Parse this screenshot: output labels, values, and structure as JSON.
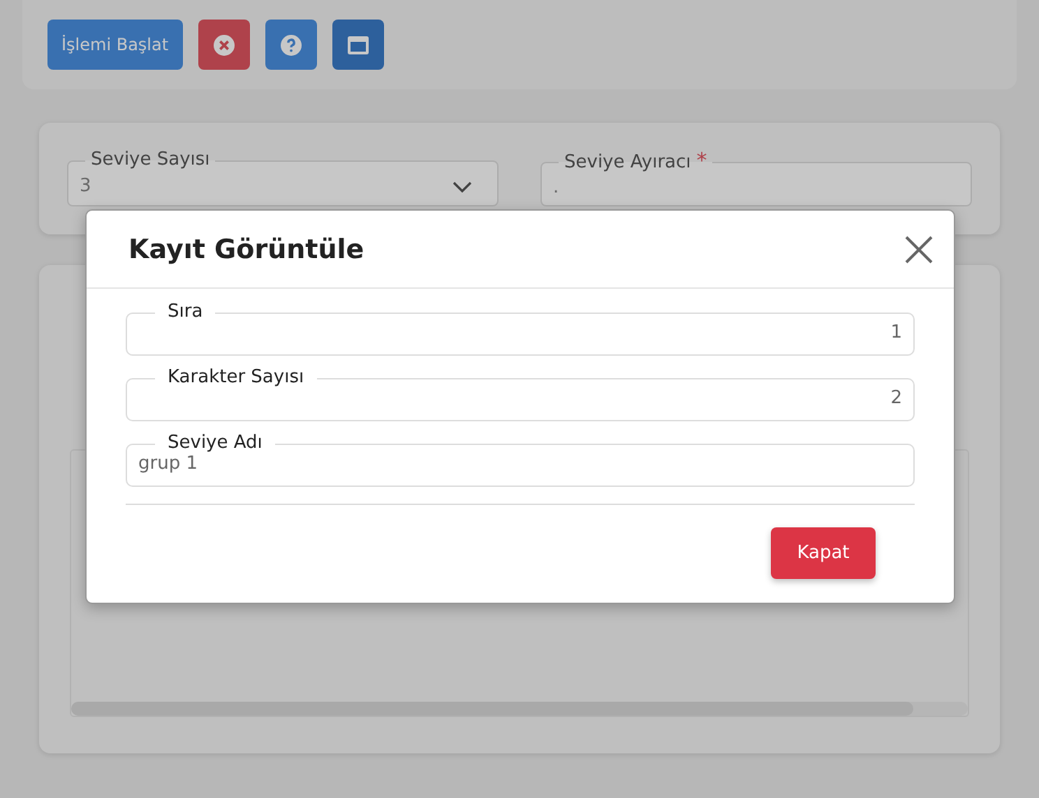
{
  "toolbar": {
    "buttons": [
      {
        "kind": "text",
        "label": "İşlemi Başlat"
      },
      {
        "kind": "cancel"
      },
      {
        "kind": "help"
      },
      {
        "kind": "window"
      }
    ]
  },
  "settings": {
    "fields": [
      {
        "label": "Seviye Sayısı",
        "value": "3",
        "kind": "select",
        "required": false
      },
      {
        "label": "Seviye Ayıracı",
        "value": ".",
        "kind": "text",
        "required": true,
        "required_mark": "*"
      }
    ]
  },
  "dialog": {
    "title": "Kayıt Görüntüle",
    "fields": [
      {
        "label": "Sıra",
        "value": "1",
        "kind": "number"
      },
      {
        "label": "Karakter Sayısı",
        "value": "2",
        "kind": "number"
      },
      {
        "label": "Seviye Adı",
        "value": "grup 1",
        "kind": "text"
      }
    ],
    "close_button": "Kapat"
  }
}
